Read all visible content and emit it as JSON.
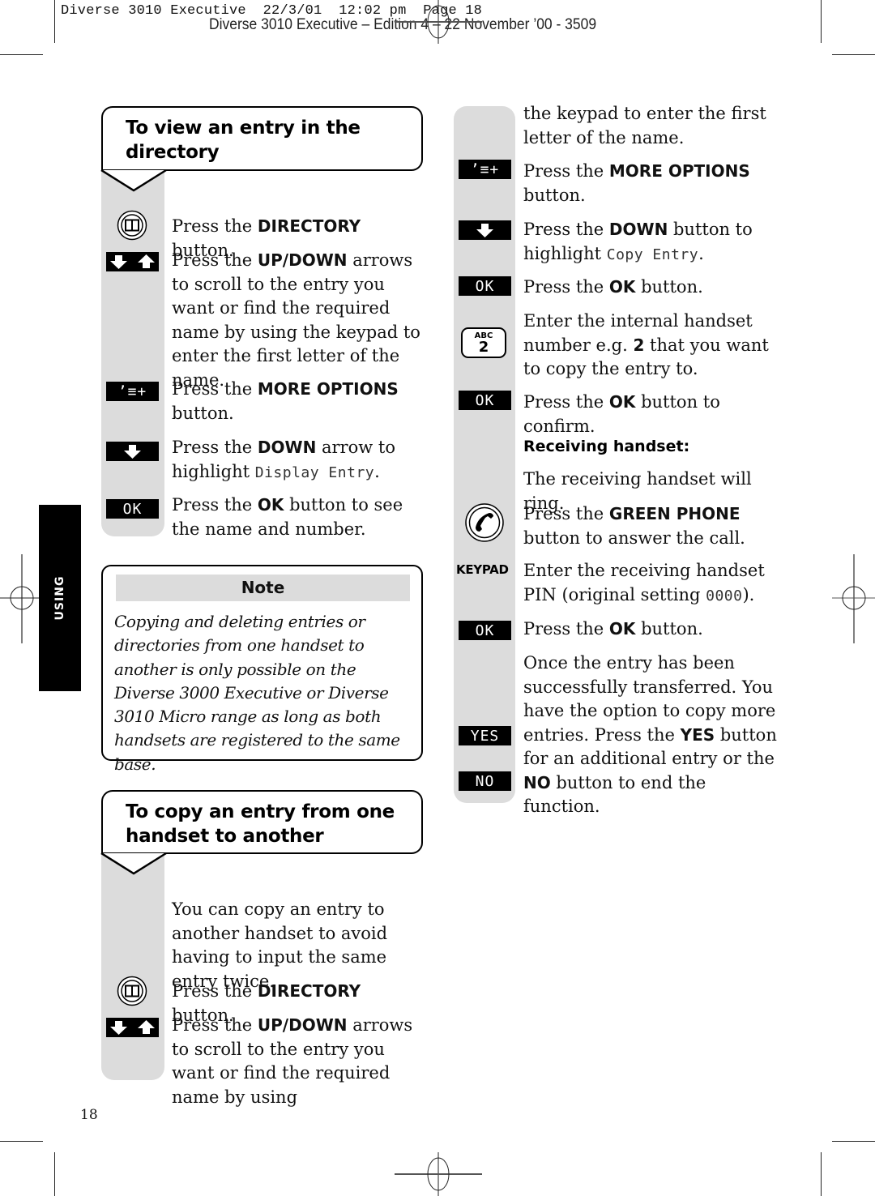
{
  "print_slug": {
    "job_line": "Diverse 3010 Executive  22/3/01  12:02 pm  Page 18",
    "edition_line": "Diverse 3010 Executive – Edition 4 – 22 November ’00 - 3509"
  },
  "side_tab": {
    "label": "USING"
  },
  "section_view": {
    "title_line1": "To view an entry in the",
    "title_line2": "directory",
    "steps": [
      {
        "icon": "directory-book-icon",
        "pre": "Press the ",
        "bold": "DIRECTORY",
        "post": " button."
      },
      {
        "icon": "up-down-arrows-icon",
        "pre": "Press the ",
        "bold": "UP/DOWN",
        "post": " arrows to scroll to the entry you want or find the required name by using the keypad to enter the first letter of the name."
      },
      {
        "icon": "more-options-icon",
        "key_label": "ʼ≡+",
        "pre": "Press the ",
        "bold": "MORE OPTIONS",
        "post": " button."
      },
      {
        "icon": "down-arrow-icon",
        "pre": "Press the ",
        "bold": "DOWN",
        "post": " arrow to highlight ",
        "lcd": "Display Entry",
        "post2": "."
      },
      {
        "icon": "ok-key-icon",
        "key_label": "OK",
        "pre": "Press the ",
        "bold": "OK",
        "post": " button to see the name and number."
      }
    ]
  },
  "note": {
    "title": "Note",
    "body": "Copying and deleting entries or directories from one handset to another is only possible on the Diverse 3000 Executive or Diverse 3010 Micro range as long as both handsets are registered to the same base."
  },
  "section_copy": {
    "title_line1": "To copy an entry from one",
    "title_line2": "handset to another",
    "intro": "You can copy an entry to another handset to avoid having to input the same entry twice.",
    "steps": [
      {
        "icon": "directory-book-icon",
        "pre": "Press the ",
        "bold": "DIRECTORY",
        "post": " button."
      },
      {
        "icon": "up-down-arrows-icon",
        "pre": "Press the ",
        "bold": "UP/DOWN",
        "post": " arrows to scroll to the entry you want or find the required name by using"
      }
    ]
  },
  "right_column": {
    "continued": "the keypad to enter the first letter of the name.",
    "steps": [
      {
        "icon": "more-options-icon",
        "key_label": "ʼ≡+",
        "pre": "Press the ",
        "bold": "MORE OPTIONS",
        "post": " button."
      },
      {
        "icon": "down-arrow-icon",
        "pre": "Press the ",
        "bold": "DOWN",
        "post": " button to highlight ",
        "lcd": "Copy Entry",
        "post2": "."
      },
      {
        "icon": "ok-key-icon",
        "key_label": "OK",
        "pre": "Press the ",
        "bold": "OK",
        "post": " button."
      },
      {
        "icon": "keypad-2-icon",
        "key_top": "ABC",
        "key_num": "2",
        "pre": "Enter the internal handset number e.g. ",
        "bold": "2",
        "post": " that you want to copy the entry to."
      },
      {
        "icon": "ok-key-icon",
        "key_label": "OK",
        "pre": "Press the ",
        "bold": "OK",
        "post": " button to confirm."
      }
    ],
    "receiving_heading": "Receiving handset:",
    "receiving_intro": "The receiving handset will ring.",
    "receiving_steps": [
      {
        "icon": "green-phone-icon",
        "pre": "Press the ",
        "bold": "GREEN PHONE",
        "post": " button to answer the call."
      },
      {
        "icon": "keypad-label",
        "label": "KEYPAD",
        "pre": "Enter the receiving handset PIN (original setting ",
        "lcd": "0000",
        "post": ")."
      },
      {
        "icon": "ok-key-icon",
        "key_label": "OK",
        "pre": "Press the ",
        "bold": "OK",
        "post": " button."
      }
    ],
    "final": {
      "line_a": "Once the entry has been successfully transferred. You have the option to copy more entries. Press the ",
      "yes_bold": "YES",
      "line_b": " button for an additional entry or the ",
      "no_bold": "NO",
      "line_c": " button to end the function.",
      "yes_key": "YES",
      "no_key": "NO"
    }
  },
  "page_number": "18"
}
